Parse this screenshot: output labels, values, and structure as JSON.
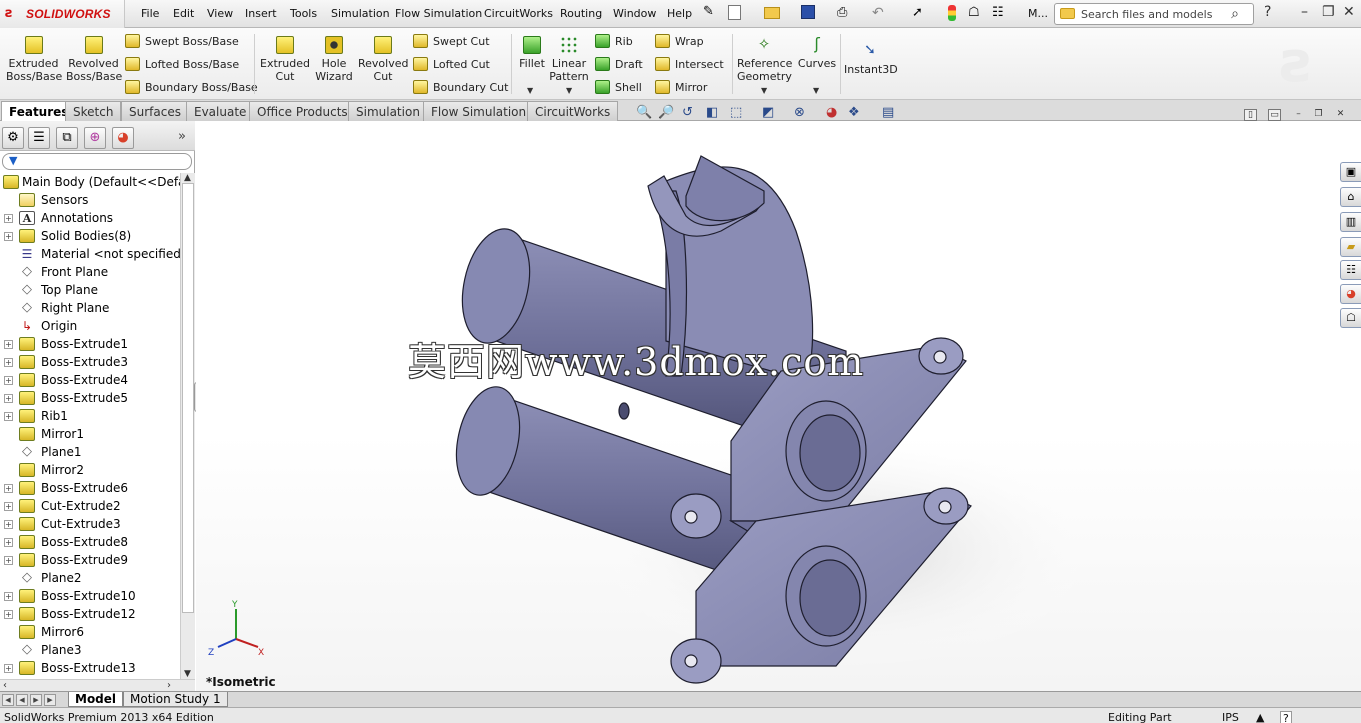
{
  "app": {
    "brand": "SOLIDWORKS",
    "brand_color": "#d01010"
  },
  "menu": [
    "File",
    "Edit",
    "View",
    "Insert",
    "Tools",
    "Simulation",
    "Flow Simulation",
    "CircuitWorks",
    "Routing",
    "Window",
    "Help"
  ],
  "toolbar_more": "M...",
  "search": {
    "placeholder": "Search files and models"
  },
  "ribbon": {
    "extruded_boss": "Extruded Boss/Base",
    "revolved_boss": "Revolved Boss/Base",
    "swept_boss": "Swept Boss/Base",
    "lofted_boss": "Lofted Boss/Base",
    "boundary_boss": "Boundary Boss/Base",
    "extruded_cut": "Extruded Cut",
    "hole_wizard": "Hole Wizard",
    "revolved_cut": "Revolved Cut",
    "swept_cut": "Swept Cut",
    "lofted_cut": "Lofted Cut",
    "boundary_cut": "Boundary Cut",
    "fillet": "Fillet",
    "linear_pattern": "Linear Pattern",
    "rib": "Rib",
    "draft": "Draft",
    "shell": "Shell",
    "wrap": "Wrap",
    "intersect": "Intersect",
    "mirror": "Mirror",
    "reference_geometry": "Reference Geometry",
    "curves": "Curves",
    "instant3d": "Instant3D"
  },
  "tabs": [
    "Features",
    "Sketch",
    "Surfaces",
    "Evaluate",
    "Office Products",
    "Simulation",
    "Flow Simulation",
    "CircuitWorks"
  ],
  "tree": {
    "root": "Main Body  (Default<<Default",
    "items": [
      {
        "label": "Sensors",
        "icon": "sensor-icon",
        "exp": false
      },
      {
        "label": "Annotations",
        "icon": "annotations-icon",
        "exp": true
      },
      {
        "label": "Solid Bodies(8)",
        "icon": "solid-bodies-icon",
        "exp": true
      },
      {
        "label": "Material <not specified>",
        "icon": "material-icon",
        "exp": false
      },
      {
        "label": "Front Plane",
        "icon": "plane-icon",
        "exp": false
      },
      {
        "label": "Top Plane",
        "icon": "plane-icon",
        "exp": false
      },
      {
        "label": "Right Plane",
        "icon": "plane-icon",
        "exp": false
      },
      {
        "label": "Origin",
        "icon": "origin-icon",
        "exp": false
      },
      {
        "label": "Boss-Extrude1",
        "icon": "feature-icon",
        "exp": true
      },
      {
        "label": "Boss-Extrude3",
        "icon": "feature-icon",
        "exp": true
      },
      {
        "label": "Boss-Extrude4",
        "icon": "feature-icon",
        "exp": true
      },
      {
        "label": "Boss-Extrude5",
        "icon": "feature-icon",
        "exp": true
      },
      {
        "label": "Rib1",
        "icon": "feature-icon",
        "exp": true
      },
      {
        "label": "Mirror1",
        "icon": "feature-icon",
        "exp": false
      },
      {
        "label": "Plane1",
        "icon": "plane-icon",
        "exp": false
      },
      {
        "label": "Mirror2",
        "icon": "feature-icon",
        "exp": false
      },
      {
        "label": "Boss-Extrude6",
        "icon": "feature-icon",
        "exp": true
      },
      {
        "label": "Cut-Extrude2",
        "icon": "feature-icon",
        "exp": true
      },
      {
        "label": "Cut-Extrude3",
        "icon": "feature-icon",
        "exp": true
      },
      {
        "label": "Boss-Extrude8",
        "icon": "feature-icon",
        "exp": true
      },
      {
        "label": "Boss-Extrude9",
        "icon": "feature-icon",
        "exp": true
      },
      {
        "label": "Plane2",
        "icon": "plane-icon",
        "exp": false
      },
      {
        "label": "Boss-Extrude10",
        "icon": "feature-icon",
        "exp": true
      },
      {
        "label": "Boss-Extrude12",
        "icon": "feature-icon",
        "exp": true
      },
      {
        "label": "Mirror6",
        "icon": "feature-icon",
        "exp": false
      },
      {
        "label": "Plane3",
        "icon": "plane-icon",
        "exp": false
      },
      {
        "label": "Boss-Extrude13",
        "icon": "feature-icon",
        "exp": true
      }
    ]
  },
  "viewport": {
    "watermark": "莫西网www.3dmox.com",
    "view_name": "*Isometric",
    "triad": {
      "x": "X",
      "y": "Y",
      "z": "Z"
    }
  },
  "bottom_tabs": [
    "Model",
    "Motion Study 1"
  ],
  "status": {
    "left": "SolidWorks Premium 2013 x64 Edition",
    "mode": "Editing Part",
    "units": "IPS",
    "help": "?"
  }
}
